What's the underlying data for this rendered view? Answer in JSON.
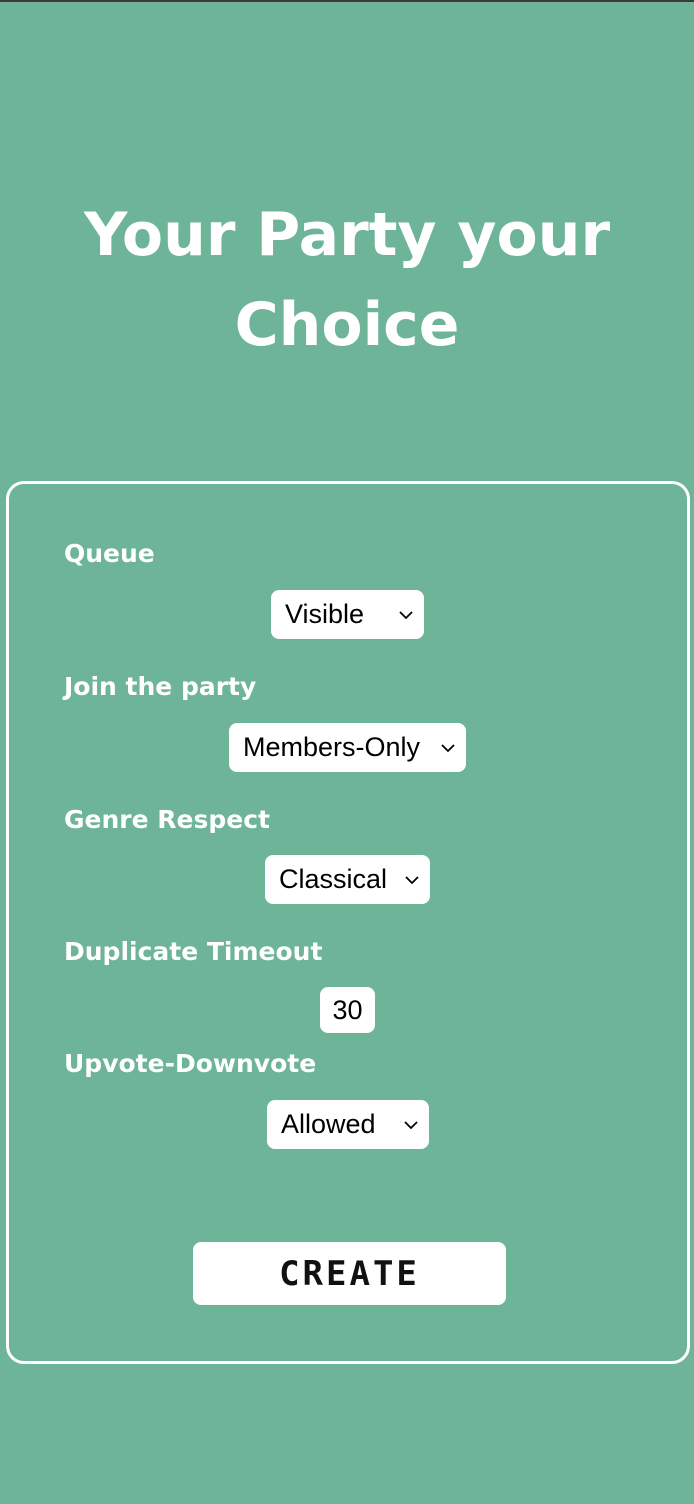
{
  "header": {
    "title_line1": "Your Party your",
    "title_line2": "Choice"
  },
  "form": {
    "queue": {
      "label": "Queue",
      "value": "Visible"
    },
    "join": {
      "label": "Join the party",
      "value": "Members-Only"
    },
    "genre": {
      "label": "Genre Respect",
      "value": "Classical"
    },
    "duplicate": {
      "label": "Duplicate Timeout",
      "value": "30"
    },
    "vote": {
      "label": "Upvote-Downvote",
      "value": "Allowed"
    },
    "create_label": "CREATE"
  },
  "colors": {
    "background": "#6db499",
    "foreground": "#ffffff"
  },
  "icons": {
    "select_chevron": "chevron-down-icon"
  }
}
